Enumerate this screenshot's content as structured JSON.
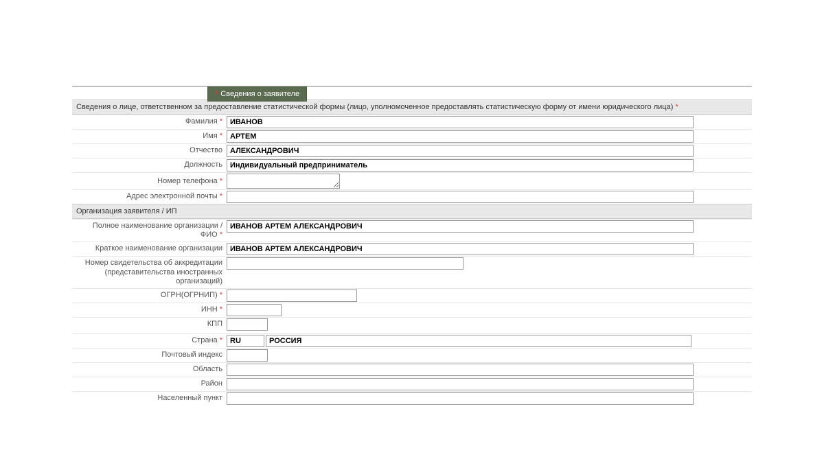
{
  "tab": {
    "label": "Сведения о заявителе"
  },
  "sections": {
    "responsible": {
      "title": "Сведения о лице, ответственном за предоставление статистической формы (лицо, уполномоченное предоставлять статистическую форму от имени юридического лица)"
    },
    "organization": {
      "title": "Организация заявителя / ИП"
    }
  },
  "fields": {
    "lastname": {
      "label": "Фамилия",
      "value": "ИВАНОВ"
    },
    "firstname": {
      "label": "Имя",
      "value": "АРТЕМ"
    },
    "patronymic": {
      "label": "Отчество",
      "value": "АЛЕКСАНДРОВИЧ"
    },
    "position": {
      "label": "Должность",
      "value": "Индивидуальный предприниматель"
    },
    "phone": {
      "label": "Номер телефона",
      "value": ""
    },
    "email": {
      "label": "Адрес электронной почты",
      "value": ""
    },
    "fullname": {
      "label": "Полное наименование организации / ФИО",
      "value": "ИВАНОВ АРТЕМ АЛЕКСАНДРОВИЧ"
    },
    "shortname": {
      "label": "Краткое наименование организации",
      "value": "ИВАНОВ АРТЕМ АЛЕКСАНДРОВИЧ"
    },
    "accreditation": {
      "label": "Номер свидетельства об аккредитации (представительства иностранных организаций)",
      "value": ""
    },
    "ogrn": {
      "label": "ОГРН(ОГРНИП)",
      "value": ""
    },
    "inn": {
      "label": "ИНН",
      "value": ""
    },
    "kpp": {
      "label": "КПП",
      "value": ""
    },
    "country": {
      "label": "Страна",
      "code": "RU",
      "name": "РОССИЯ"
    },
    "postcode": {
      "label": "Почтовый индекс",
      "value": ""
    },
    "region": {
      "label": "Область",
      "value": ""
    },
    "district": {
      "label": "Район",
      "value": ""
    },
    "city": {
      "label": "Населенный пункт",
      "value": ""
    }
  }
}
